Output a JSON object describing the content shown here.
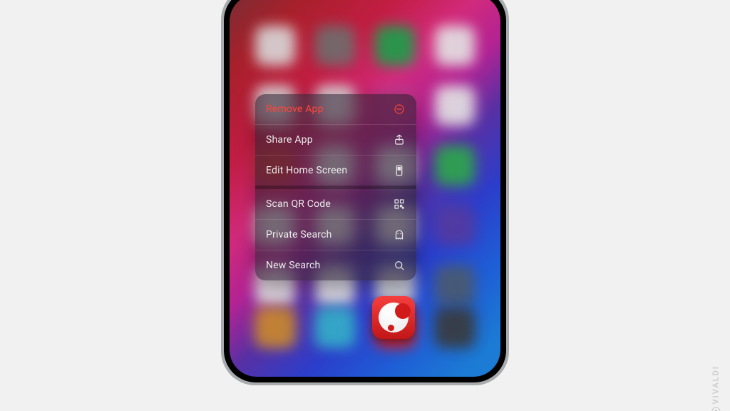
{
  "watermark": "VIVALDI",
  "focused_app": {
    "name": "Vivaldi"
  },
  "menu": {
    "groups": [
      [
        {
          "id": "remove",
          "label": "Remove App",
          "icon": "minus-circle-icon",
          "destructive": true
        },
        {
          "id": "share",
          "label": "Share App",
          "icon": "share-icon"
        },
        {
          "id": "edit",
          "label": "Edit Home Screen",
          "icon": "phone-apps-icon"
        }
      ],
      [
        {
          "id": "qr",
          "label": "Scan QR Code",
          "icon": "qr-icon"
        },
        {
          "id": "private",
          "label": "Private Search",
          "icon": "ghost-icon"
        },
        {
          "id": "search",
          "label": "New Search",
          "icon": "search-icon"
        }
      ]
    ]
  },
  "blur_rows": [
    [
      "#d9d9d9",
      "#6e6e6e",
      "#1aa04a",
      "#e4e4e4"
    ],
    [
      "#e4e4e4",
      "#e4e4e4",
      "#c63a8e",
      "#e4e4e4"
    ],
    [
      "#d33a3a",
      "#e4e4e4",
      "#e4e4e4",
      "#2ca84a"
    ],
    [
      "#e4e4e4",
      "#e4e4e4",
      "#e4e4e4",
      "#543aa0"
    ],
    [
      "#e4e4e4",
      "#e4e4e4",
      "#d6d6d6",
      "#4a5a6e"
    ],
    [
      "#cc8a2a",
      "#34b0c8",
      "#d11a1a",
      "#3a3a3a"
    ]
  ]
}
